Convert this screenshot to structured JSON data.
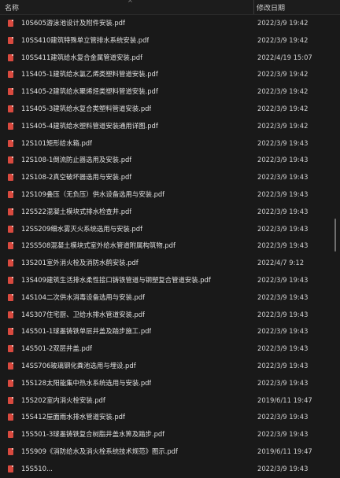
{
  "header": {
    "name_label": "名称",
    "date_label": "修改日期",
    "sort_indicator": "^"
  },
  "files": [
    {
      "name": "10S605游泳池设计及附件安装.pdf",
      "date": "2022/3/9 19:42"
    },
    {
      "name": "10SS410建筑特殊单立管排水系统安装.pdf",
      "date": "2022/3/9 19:42"
    },
    {
      "name": "10SS411建筑给水复合金属管道安装.pdf",
      "date": "2022/4/19 15:07"
    },
    {
      "name": "11S405-1建筑给水氯乙烯类塑料管道安装.pdf",
      "date": "2022/3/9 19:42"
    },
    {
      "name": "11S405-2建筑给水聚烯烃类塑料管道安装.pdf",
      "date": "2022/3/9 19:42"
    },
    {
      "name": "11S405-3建筑给水复合类塑料管道安装.pdf",
      "date": "2022/3/9 19:42"
    },
    {
      "name": "11S405-4建筑给水塑料管道安装通用详图.pdf",
      "date": "2022/3/9 19:42"
    },
    {
      "name": "12S101矩形给水箱.pdf",
      "date": "2022/3/9 19:43"
    },
    {
      "name": "12S108-1倒流防止器选用及安装.pdf",
      "date": "2022/3/9 19:43"
    },
    {
      "name": "12S108-2真空破坏器选用与安装.pdf",
      "date": "2022/3/9 19:43"
    },
    {
      "name": "12S109叠压（无负压）供水设备选用与安装.pdf",
      "date": "2022/3/9 19:43"
    },
    {
      "name": "12S522混凝土模块式排水检查井.pdf",
      "date": "2022/3/9 19:43"
    },
    {
      "name": "12SS209细水雾灭火系统选用与安装.pdf",
      "date": "2022/3/9 19:43"
    },
    {
      "name": "12SS508混凝土模块式室外给水管道附属构筑物.pdf",
      "date": "2022/3/9 19:43"
    },
    {
      "name": "13S201室外消火栓及消防水鹤安装.pdf",
      "date": "2022/4/7 9:12"
    },
    {
      "name": "13S409建筑生活排水柔性接口铸铁管道与钢塑复合管道安装.pdf",
      "date": "2022/3/9 19:43"
    },
    {
      "name": "14S104二次供水消毒设备选用与安装.pdf",
      "date": "2022/3/9 19:43"
    },
    {
      "name": "14S307住宅厨、卫给水排水管道安装.pdf",
      "date": "2022/3/9 19:43"
    },
    {
      "name": "14S501-1球墨铸铁单层井盖及踏步施工.pdf",
      "date": "2022/3/9 19:43"
    },
    {
      "name": "14S501-2双层井盖.pdf",
      "date": "2022/3/9 19:43"
    },
    {
      "name": "14SS706玻璃钢化粪池选用与埋设.pdf",
      "date": "2022/3/9 19:43"
    },
    {
      "name": "15S128太阳能集中热水系统选用与安装.pdf",
      "date": "2022/3/9 19:43"
    },
    {
      "name": "15S202室内消火栓安装.pdf",
      "date": "2019/6/11 19:47"
    },
    {
      "name": "15S412屋面雨水排水管道安装.pdf",
      "date": "2022/3/9 19:43"
    },
    {
      "name": "15S501-3球墨铸铁复合树脂井盖水箅及踏步.pdf",
      "date": "2022/3/9 19:43"
    },
    {
      "name": "15S909《消防给水及消火栓系统技术规范》图示.pdf",
      "date": "2019/6/11 19:47"
    },
    {
      "name": "15S510...",
      "date": "2022/3/9 19:43"
    }
  ]
}
